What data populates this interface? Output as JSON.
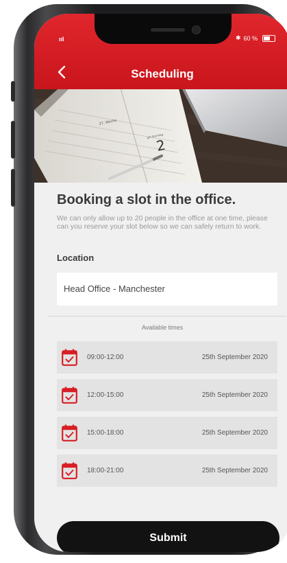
{
  "status_bar": {
    "signal": "ııl",
    "bluetooth": "✱",
    "battery_percent": "60 %"
  },
  "header": {
    "back_glyph": "‹",
    "title": "Scheduling"
  },
  "hero": {
    "diary_number": "2",
    "diary_week_label": "27. Woche",
    "diary_day_label": "Juli Sonntag"
  },
  "main": {
    "heading": "Booking a slot in the office.",
    "description": "We can only allow up to 20 people in the office at one time, please can you reserve your slot below so we can safely return to work.",
    "location_label": "Location",
    "location_value": "Head Office - Manchester",
    "available_label": "Available times",
    "slots": [
      {
        "time": "09:00-12:00",
        "date": "25th September 2020"
      },
      {
        "time": "12:00-15:00",
        "date": "25th September 2020"
      },
      {
        "time": "15:00-18:00",
        "date": "25th September 2020"
      },
      {
        "time": "18:00-21:00",
        "date": "25th September 2020"
      }
    ],
    "submit_label": "Submit"
  },
  "colors": {
    "brand_red": "#d81e25",
    "submit_bg": "#121212",
    "slot_bg": "#e3e3e3"
  },
  "icons": {
    "back": "chevron-left-icon",
    "calendar": "calendar-check-icon",
    "battery": "battery-icon",
    "bluetooth": "bluetooth-icon",
    "signal": "signal-icon"
  }
}
